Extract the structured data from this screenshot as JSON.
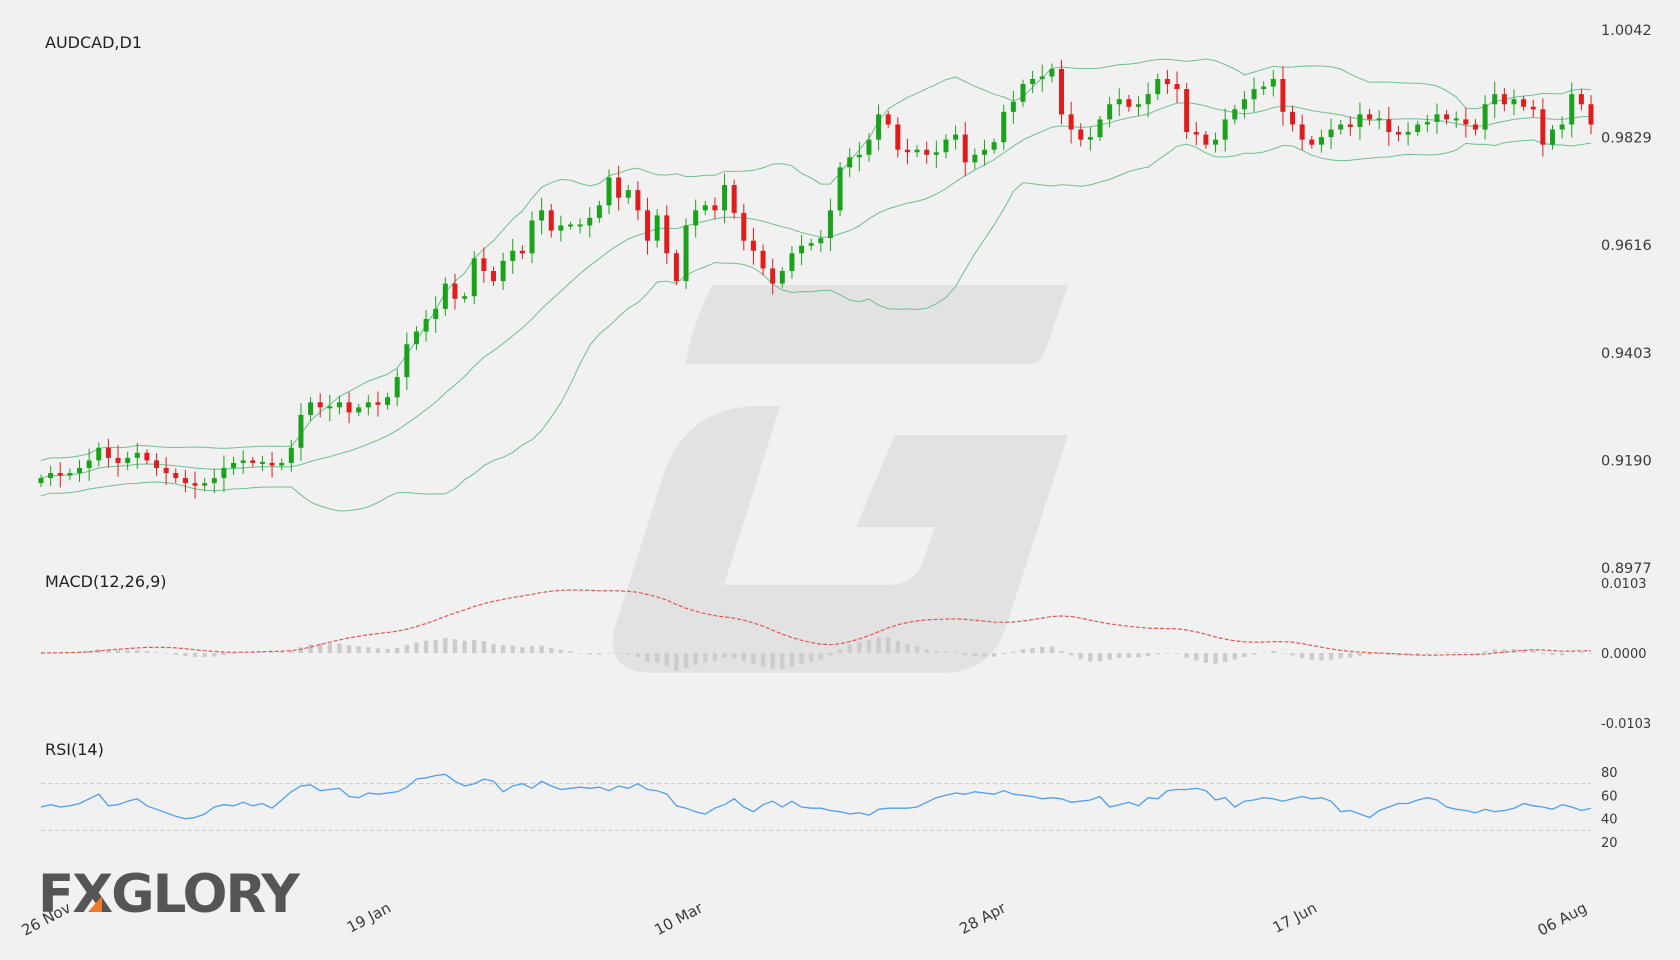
{
  "titles": {
    "main": "AUDCAD,D1",
    "macd": "MACD(12,26,9)",
    "rsi": "RSI(14)"
  },
  "logo": {
    "text": "FXGLORY",
    "accent_color": "#f07a28"
  },
  "colors": {
    "bull": "#1aa31a",
    "bear": "#e01c1c",
    "bands": "#6fbf8f",
    "signal": "#e8544e",
    "histogram": "#cccccc",
    "rsi": "#4d9ff0",
    "rsi_levels": "#c8c8c8",
    "watermark": "#e2e2e2"
  },
  "chart_data": [
    {
      "type": "candlestick",
      "title": "AUDCAD,D1",
      "y_ticks": [
        "1.0042",
        "0.9829",
        "0.9616",
        "0.9403",
        "0.9190",
        "0.8977"
      ],
      "ylim": [
        0.8977,
        1.0042
      ],
      "x_labels": [
        "26 Nov",
        "19 Jan",
        "10 Mar",
        "28 Apr",
        "17 Jun",
        "06 Aug"
      ],
      "overlays": [
        "bollinger upper",
        "bollinger middle",
        "bollinger lower"
      ],
      "closes": [
        0.9155,
        0.9165,
        0.916,
        0.9165,
        0.9175,
        0.919,
        0.9215,
        0.9195,
        0.9185,
        0.9195,
        0.9205,
        0.919,
        0.9175,
        0.9165,
        0.9155,
        0.9145,
        0.914,
        0.9145,
        0.9155,
        0.9175,
        0.9185,
        0.919,
        0.9185,
        0.9185,
        0.918,
        0.9185,
        0.9215,
        0.928,
        0.9305,
        0.9295,
        0.9295,
        0.9305,
        0.9285,
        0.9295,
        0.9305,
        0.93,
        0.9315,
        0.9355,
        0.942,
        0.9445,
        0.947,
        0.949,
        0.954,
        0.951,
        0.9515,
        0.959,
        0.9565,
        0.9545,
        0.9585,
        0.9605,
        0.96,
        0.9665,
        0.9685,
        0.9645,
        0.9655,
        0.9655,
        0.9655,
        0.967,
        0.9695,
        0.975,
        0.971,
        0.9725,
        0.9685,
        0.9625,
        0.9675,
        0.96,
        0.9545,
        0.9655,
        0.9685,
        0.9695,
        0.9685,
        0.9735,
        0.968,
        0.9625,
        0.9605,
        0.957,
        0.954,
        0.9565,
        0.96,
        0.9615,
        0.962,
        0.963,
        0.9685,
        0.977,
        0.979,
        0.9795,
        0.9825,
        0.9875,
        0.9855,
        0.9805,
        0.98,
        0.9805,
        0.9795,
        0.98,
        0.9825,
        0.9835,
        0.978,
        0.9795,
        0.9805,
        0.982,
        0.988,
        0.99,
        0.9935,
        0.9945,
        0.995,
        0.9965,
        0.9875,
        0.9845,
        0.9825,
        0.983,
        0.9865,
        0.9895,
        0.9905,
        0.989,
        0.9895,
        0.9915,
        0.9945,
        0.9935,
        0.9925,
        0.984,
        0.9835,
        0.9815,
        0.9825,
        0.9865,
        0.9885,
        0.9905,
        0.9925,
        0.993,
        0.9945,
        0.988,
        0.9855,
        0.9825,
        0.9815,
        0.983,
        0.9845,
        0.9855,
        0.985,
        0.9875,
        0.9865,
        0.9865,
        0.984,
        0.9835,
        0.984,
        0.9855,
        0.986,
        0.9875,
        0.9865,
        0.9865,
        0.9855,
        0.9845,
        0.9895,
        0.9915,
        0.9895,
        0.9905,
        0.989,
        0.9885,
        0.9815,
        0.9845,
        0.9855,
        0.9915,
        0.9895,
        0.9855
      ]
    },
    {
      "type": "line+histogram",
      "title": "MACD(12,26,9)",
      "y_ticks": [
        "0.0103",
        "0.0000",
        "-0.0103"
      ],
      "ylim": [
        -0.0103,
        0.0103
      ],
      "series": [
        "MACD histogram",
        "signal line"
      ]
    },
    {
      "type": "line",
      "title": "RSI(14)",
      "y_ticks": [
        "80",
        "60",
        "40",
        "20"
      ],
      "levels": [
        70,
        30
      ],
      "ylim": [
        20,
        80
      ],
      "values": [
        50,
        52,
        50,
        51,
        53,
        57,
        61,
        51,
        52,
        55,
        57,
        51,
        48,
        45,
        42,
        40,
        41,
        44,
        50,
        52,
        51,
        54,
        51,
        53,
        49,
        56,
        63,
        68,
        69,
        64,
        65,
        66,
        59,
        58,
        62,
        61,
        62,
        63,
        67,
        74,
        75,
        77,
        78,
        72,
        68,
        70,
        74,
        72,
        63,
        68,
        70,
        66,
        72,
        68,
        65,
        66,
        67,
        66,
        67,
        64,
        68,
        66,
        70,
        65,
        64,
        61,
        51,
        49,
        46,
        44,
        49,
        52,
        57,
        50,
        46,
        52,
        55,
        50,
        55,
        50,
        49,
        49,
        47,
        46,
        44,
        45,
        43,
        48,
        49,
        49,
        49,
        50,
        54,
        58,
        60,
        62,
        61,
        63,
        62,
        61,
        64,
        61,
        60,
        59,
        57,
        58,
        57,
        54,
        55,
        56,
        59,
        50,
        52,
        54,
        51,
        58,
        57,
        64,
        65,
        65,
        66,
        64,
        56,
        58,
        50,
        55,
        56,
        58,
        57,
        55,
        57,
        59,
        57,
        58,
        55,
        46,
        47,
        44,
        41,
        47,
        50,
        53,
        53,
        56,
        58,
        56,
        50,
        48,
        47,
        45,
        48,
        46,
        47,
        49,
        53,
        51,
        50,
        48,
        52,
        50,
        47,
        49
      ]
    }
  ]
}
